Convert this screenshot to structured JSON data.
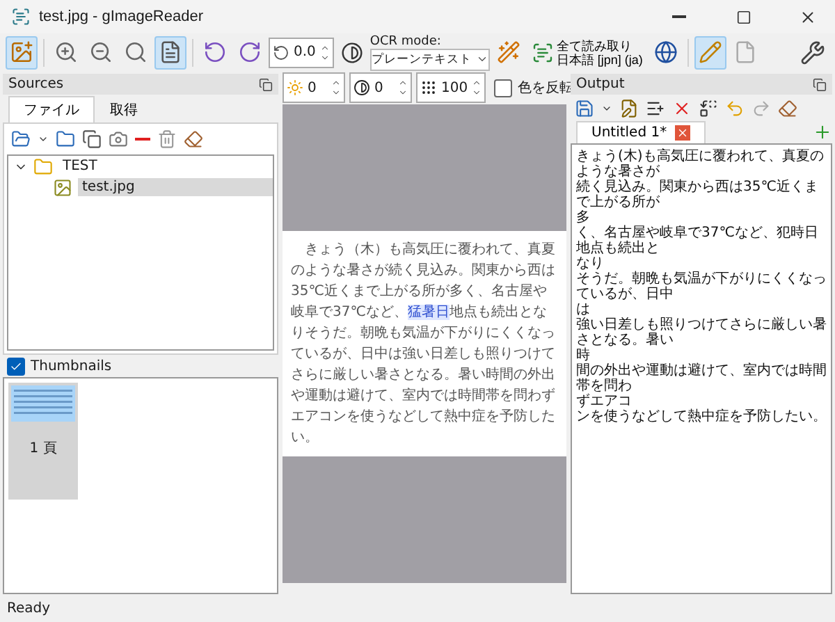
{
  "window": {
    "title": "test.jpg - gImageReader"
  },
  "toolbar": {
    "left_buttons": [
      {
        "kind": "addimage",
        "selected": true
      },
      {
        "kind": "zoomin",
        "selected": false
      },
      {
        "kind": "zoomout",
        "selected": false
      },
      {
        "kind": "zoomfit",
        "selected": false
      },
      {
        "kind": "autopage",
        "selected": true
      },
      {
        "kind": "rotleft",
        "selected": false
      },
      {
        "kind": "rotright",
        "selected": false
      }
    ],
    "rotation": "0.0",
    "ocr_mode": {
      "label": "OCR mode:",
      "value": "プレーンテキスト"
    },
    "recognize": {
      "line_1": "全て読み取り",
      "line_2": "日本語 [jpn] (ja)"
    },
    "right_buttons": [
      {
        "kind": "language",
        "selected": false
      },
      {
        "kind": "edit",
        "selected": true
      },
      {
        "kind": "blank",
        "selected": false
      }
    ]
  },
  "sources": {
    "title": "Sources",
    "tabs": [
      {
        "label": "ファイル",
        "selected": true
      },
      {
        "label": "取得",
        "selected": false
      }
    ],
    "tree": [
      {
        "label": "TEST",
        "expanded": true,
        "selected": false,
        "children": [
          {
            "label": "test.jpg",
            "selected": true
          }
        ]
      }
    ],
    "thumbnails": {
      "label": "Thumbnails",
      "checked": true,
      "pages": [
        {
          "label": "1 頁",
          "selected": true
        }
      ]
    }
  },
  "viewer": {
    "brightness": "0",
    "contrast": "0",
    "resolution": "100",
    "invert": {
      "label": "色を反転",
      "checked": false
    },
    "page_text": {
      "before": "きょう（木）も高気圧に覆われて、真夏のような暑さが続く見込み。関東から西は35℃近くまで上がる所が多く、名古屋や岐阜で37℃など、",
      "highlight": "猛暑日",
      "after": "地点も続出となりそうだ。朝晩も気温が下がりにくくなっているが、日中は強い日差しも照りつけてさらに厳しい暑さとなる。暑い時間の外出や運動は避けて、室内では時間帯を問わずエアコンを使うなどして熱中症を予防したい。"
    }
  },
  "output": {
    "title": "Output",
    "tabs": [
      {
        "label": "Untitled 1*",
        "selected": true
      }
    ],
    "lines": [
      "きょう(木)も高気圧に覆われて、真夏のような暑さが",
      "続く見込み。関東から西は35℃近くまで上がる所が",
      "多",
      "く、名古屋や岐阜で37℃など、犯時日地点も続出と",
      "なり",
      "そうだ。朝晩も気温が下がりにくくなっているが、日中",
      "は",
      "強い日差しも照りつけてさらに厳しい暑さとなる。暑い",
      "時",
      "間の外出や運動は避けて、室内では時間帯を問わ",
      "ずエアコ",
      "ンを使うなどして熱中症を予防したい。"
    ]
  },
  "status_bar": "Ready"
}
